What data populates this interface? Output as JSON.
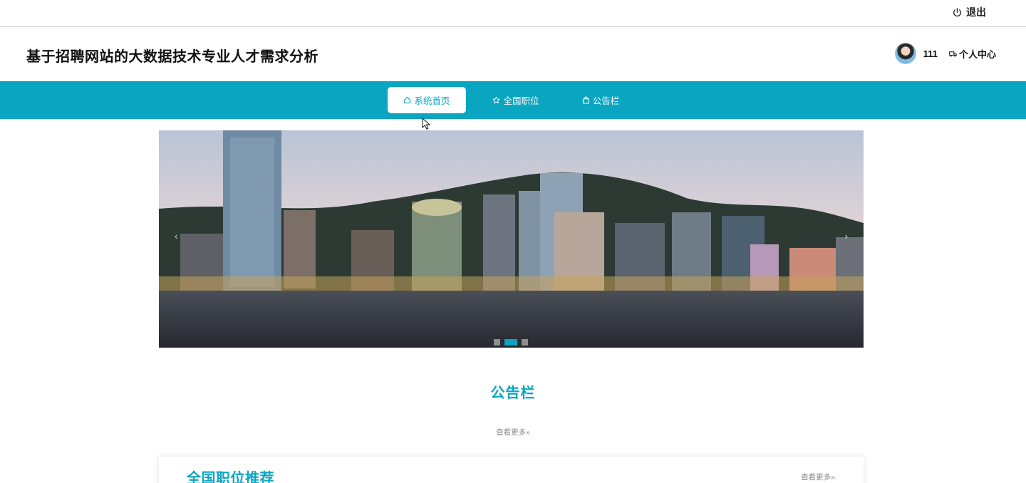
{
  "topbar": {
    "logout_label": "退出"
  },
  "header": {
    "site_title": "基于招聘网站的大数据技术专业人才需求分析",
    "username": "111",
    "personal_center_label": "个人中心"
  },
  "nav": {
    "items": [
      {
        "label": "系统首页"
      },
      {
        "label": "全国职位"
      },
      {
        "label": "公告栏"
      }
    ]
  },
  "carousel": {
    "slide_count": 3,
    "active_index": 1,
    "prev": "‹",
    "next": "›"
  },
  "notice": {
    "title": "公告栏",
    "more_label": "查看更多»"
  },
  "recommend": {
    "title": "全国职位推荐",
    "more_label": "查看更多»"
  },
  "colors": {
    "accent": "#0aa5c1"
  }
}
